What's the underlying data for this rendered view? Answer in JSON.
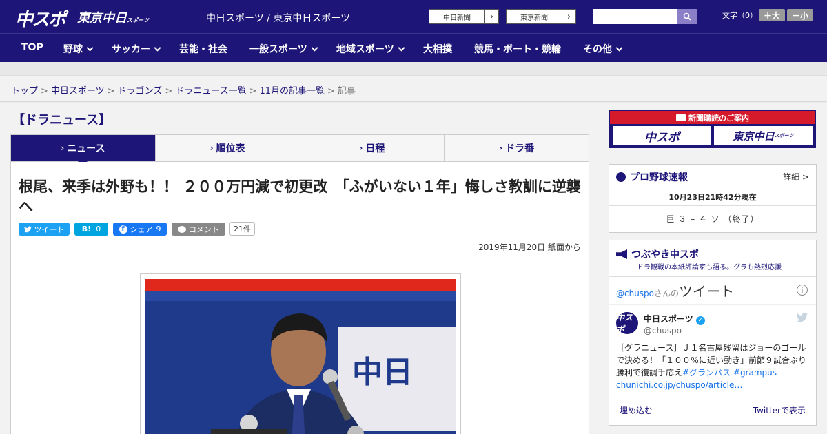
{
  "header": {
    "logo_main": "中スポ",
    "logo_sub": "東京中日",
    "logo_sub_small": "スポーツ",
    "site_title": "中日スポーツ / 東京中日スポーツ",
    "paper_links": [
      "中日新聞",
      "東京新聞"
    ],
    "font_label": "文字（0）",
    "font_plus": "＋大",
    "font_minus": "－小"
  },
  "nav": {
    "items": [
      {
        "label": "TOP",
        "dropdown": false
      },
      {
        "label": "野球",
        "dropdown": true
      },
      {
        "label": "サッカー",
        "dropdown": true
      },
      {
        "label": "芸能・社会",
        "dropdown": false
      },
      {
        "label": "一般スポーツ",
        "dropdown": true
      },
      {
        "label": "地域スポーツ",
        "dropdown": true
      },
      {
        "label": "大相撲",
        "dropdown": false
      },
      {
        "label": "競馬・ボート・競輪",
        "dropdown": false
      },
      {
        "label": "その他",
        "dropdown": true
      }
    ]
  },
  "breadcrumb": {
    "items": [
      "トップ",
      "中日スポーツ",
      "ドラゴンズ",
      "ドラニュース一覧",
      "11月の記事一覧"
    ],
    "current": "記事",
    "separator": ">"
  },
  "section": {
    "title": "【ドラニュース】"
  },
  "tabs": [
    {
      "label": "ニュース",
      "active": true
    },
    {
      "label": "順位表",
      "active": false
    },
    {
      "label": "日程",
      "active": false
    },
    {
      "label": "ドラ番",
      "active": false
    }
  ],
  "article": {
    "headline": "根尾、来季は外野も！！ ２００万円減で初更改　「ふがいない１年」悔しさ教訓に逆襲へ",
    "share": {
      "tweet": "ツイート",
      "hatena_label": "B!",
      "hatena_count": "0",
      "facebook": "シェア",
      "facebook_count": "9",
      "comment": "コメント",
      "comment_count": "21件"
    },
    "dateline": "2019年11月20日 紙面から",
    "photo_sign": "中日"
  },
  "sidebar": {
    "ad": {
      "title": "新聞購読のご案内",
      "logo_left": "中スポ",
      "logo_right": "東京中日",
      "logo_right_small": "スポーツ"
    },
    "baseball": {
      "title": "プロ野球速報",
      "detail": "詳細 >",
      "time": "10月23日21時42分現在",
      "score": "巨 ３ – ４ ソ （終了）"
    },
    "twitter": {
      "title": "つぶやき中スポ",
      "subtitle": "ドラ観戦の本紙評論家も語る。グラも熱烈応援",
      "handle_prefix": "@chuspo",
      "handle_suffix": "さんの",
      "handle_big": "ツイート",
      "info": "i",
      "avatar_text": "中スポ",
      "account_name": "中日スポーツ",
      "account_handle": "@chuspo",
      "tweet_text": "［グラニュース］Ｊ１名古屋残留はジョーのゴールで決める！「１００％に近い動き」前節９試合ぶり勝利で復調手応え",
      "tweet_tags": "#グランパス #grampus",
      "tweet_link": "chunichi.co.jp/chuspo/article…",
      "embed": "埋め込む",
      "view": "Twitterで表示"
    }
  },
  "colors": {
    "brand": "#1d1577",
    "accent_red": "#d51a2b",
    "twitter_blue": "#1da1f2",
    "hatena_blue": "#00a4de",
    "facebook_blue": "#1877f2",
    "comment_gray": "#888888"
  }
}
